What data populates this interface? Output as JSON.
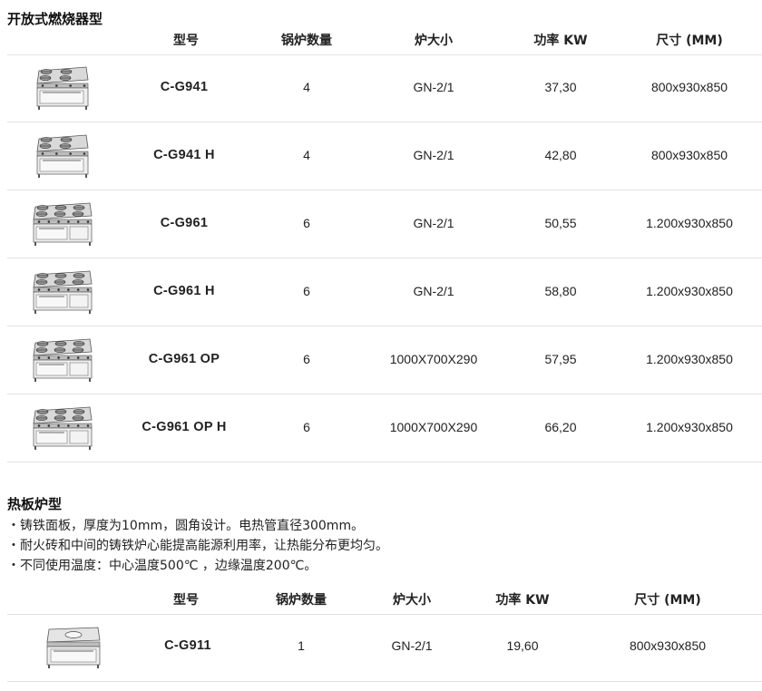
{
  "section1": {
    "title": "开放式燃烧器型",
    "headers": {
      "model": "型号",
      "burners": "锅炉数量",
      "size": "炉大小",
      "power": "功率 KW",
      "dims": "尺寸 (MM)"
    },
    "rows": [
      {
        "model": "C-G941",
        "burners": "4",
        "size": "GN-2/1",
        "power": "37,30",
        "dims": "800x930x850",
        "icon": "open-burner-range-4-icon"
      },
      {
        "model": "C-G941 H",
        "burners": "4",
        "size": "GN-2/1",
        "power": "42,80",
        "dims": "800x930x850",
        "icon": "open-burner-range-4-icon"
      },
      {
        "model": "C-G961",
        "burners": "6",
        "size": "GN-2/1",
        "power": "50,55",
        "dims": "1.200x930x850",
        "icon": "open-burner-range-6-icon"
      },
      {
        "model": "C-G961 H",
        "burners": "6",
        "size": "GN-2/1",
        "power": "58,80",
        "dims": "1.200x930x850",
        "icon": "open-burner-range-6-icon"
      },
      {
        "model": "C-G961 OP",
        "burners": "6",
        "size": "1000X700X290",
        "power": "57,95",
        "dims": "1.200x930x850",
        "icon": "open-burner-range-6-icon"
      },
      {
        "model": "C-G961 OP H",
        "burners": "6",
        "size": "1000X700X290",
        "power": "66,20",
        "dims": "1.200x930x850",
        "icon": "open-burner-range-6-icon"
      }
    ]
  },
  "section2": {
    "title": "热板炉型",
    "bullets": [
      "・铸铁面板，厚度为10mm，圆角设计。电热管直径300mm。",
      "・耐火砖和中间的铸铁炉心能提高能源利用率，让热能分布更均匀。",
      "・不同使用温度：中心温度500℃ ，边缘温度200℃。"
    ],
    "headers": {
      "model": "型号",
      "burners": "锅炉数量",
      "size": "炉大小",
      "power": "功率 KW",
      "dims": "尺寸 (MM)"
    },
    "rows": [
      {
        "model": "C-G911",
        "burners": "1",
        "size": "GN-2/1",
        "power": "19,60",
        "dims": "800x930x850",
        "icon": "hot-plate-range-icon"
      }
    ]
  }
}
